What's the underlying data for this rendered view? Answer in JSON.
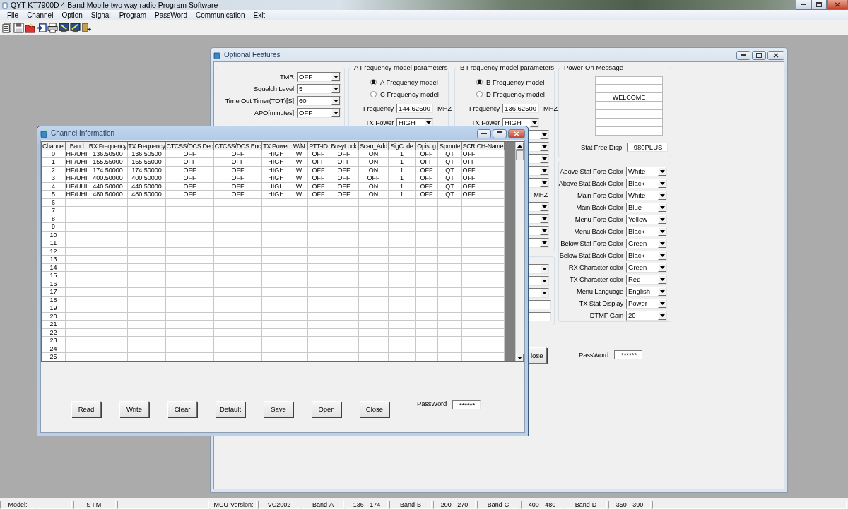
{
  "app": {
    "title": "QYT KT7900D 4 Band Mobile two way radio Program Software",
    "menu": [
      "File",
      "Channel",
      "Option",
      "Signal",
      "Program",
      "PassWord",
      "Communication",
      "Exit"
    ]
  },
  "optional_features": {
    "title": "Optional Features",
    "general": [
      {
        "label": "TMR",
        "value": "OFF"
      },
      {
        "label": "Squelch Level",
        "value": "5"
      },
      {
        "label": "Time Out Timer(TOT)[S]",
        "value": "60"
      },
      {
        "label": "APO[minutes]",
        "value": "OFF"
      }
    ],
    "a_params": {
      "legend": "A Frequency model parameters",
      "models": [
        {
          "label": "A Frequency model",
          "selected": true
        },
        {
          "label": "C Frequency model",
          "selected": false
        }
      ],
      "frequency_label": "Frequency",
      "frequency": "144.62500",
      "unit": "MHZ",
      "tx_power_label": "TX Power",
      "tx_power": "HIGH"
    },
    "b_params": {
      "legend": "B Frequency model parameters",
      "models": [
        {
          "label": "B Frequency model",
          "selected": true
        },
        {
          "label": "D Frequency model",
          "selected": false
        }
      ],
      "frequency_label": "Frequency",
      "frequency": "136.62500",
      "unit": "MHZ",
      "tx_power_label": "TX Power",
      "tx_power": "HIGH",
      "second_unit": "MHZ"
    },
    "close_button": "lose",
    "password_label": "PassWord",
    "password": "******",
    "power_on": {
      "legend": "Power-On Message",
      "lines": [
        {
          "kind": "blank"
        },
        {
          "kind": "blank"
        },
        {
          "kind": "text",
          "text": "WELCOME"
        },
        {
          "kind": "blank"
        },
        {
          "kind": "blank"
        },
        {
          "kind": "blank"
        },
        {
          "kind": "blank"
        }
      ],
      "stat_free_label": "Stat Free Disp",
      "stat_free": "980PLUS"
    },
    "colors": [
      {
        "label": "Above Stat Fore Color",
        "value": "White"
      },
      {
        "label": "Above Stat Back Color",
        "value": "Black"
      },
      {
        "label": "Main Fore Color",
        "value": "White"
      },
      {
        "label": "Main Back Color",
        "value": "Blue"
      },
      {
        "label": "Menu Fore Color",
        "value": "Yellow"
      },
      {
        "label": "Menu Back Color",
        "value": "Black"
      },
      {
        "label": "Below Stat Fore Color",
        "value": "Green"
      },
      {
        "label": "Below Stat Back Color",
        "value": "Black"
      },
      {
        "label": "RX Character color",
        "value": "Green"
      },
      {
        "label": "TX Character color",
        "value": "Red"
      },
      {
        "label": "Menu Language",
        "value": "English"
      },
      {
        "label": "TX Stat Display",
        "value": "Power"
      },
      {
        "label": "DTMF Gain",
        "value": "20"
      }
    ]
  },
  "channel_info": {
    "title": "Channel Information",
    "columns": [
      "Channel",
      "Band",
      "RX Frequency",
      "TX Frequency",
      "CTCSS/DCS Dec",
      "CTCSS/DCS Enc",
      "TX Power",
      "W/N",
      "PTT-ID",
      "BusyLock",
      "Scan_Add",
      "SigCode",
      "Opisug",
      "Spmute",
      "SCR",
      "CH-Name"
    ],
    "rows": [
      [
        "0",
        "HF/UHI",
        "136.50500",
        "136.50500",
        "OFF",
        "OFF",
        "HIGH",
        "W",
        "OFF",
        "OFF",
        "ON",
        "1",
        "OFF",
        "QT",
        "OFF"
      ],
      [
        "1",
        "HF/UHI",
        "155.55000",
        "155.55000",
        "OFF",
        "OFF",
        "HIGH",
        "W",
        "OFF",
        "OFF",
        "ON",
        "1",
        "OFF",
        "QT",
        "OFF"
      ],
      [
        "2",
        "HF/UHI",
        "174.50000",
        "174.50000",
        "OFF",
        "OFF",
        "HIGH",
        "W",
        "OFF",
        "OFF",
        "ON",
        "1",
        "OFF",
        "QT",
        "OFF"
      ],
      [
        "3",
        "HF/UHI",
        "400.50000",
        "400.50000",
        "OFF",
        "OFF",
        "HIGH",
        "W",
        "OFF",
        "OFF",
        "OFF",
        "1",
        "OFF",
        "QT",
        "OFF"
      ],
      [
        "4",
        "HF/UHI",
        "440.50000",
        "440.50000",
        "OFF",
        "OFF",
        "HIGH",
        "W",
        "OFF",
        "OFF",
        "ON",
        "1",
        "OFF",
        "QT",
        "OFF"
      ],
      [
        "5",
        "HF/UHI",
        "480.50000",
        "480.50000",
        "OFF",
        "OFF",
        "HIGH",
        "W",
        "OFF",
        "OFF",
        "ON",
        "1",
        "OFF",
        "QT",
        "OFF"
      ],
      [
        "6"
      ],
      [
        "7"
      ],
      [
        "8"
      ],
      [
        "9"
      ],
      [
        "10"
      ],
      [
        "11"
      ],
      [
        "12"
      ],
      [
        "13"
      ],
      [
        "14"
      ],
      [
        "15"
      ],
      [
        "16"
      ],
      [
        "17"
      ],
      [
        "18"
      ],
      [
        "19"
      ],
      [
        "20"
      ],
      [
        "21"
      ],
      [
        "22"
      ],
      [
        "23"
      ],
      [
        "24"
      ],
      [
        "25"
      ]
    ],
    "buttons": [
      "Read",
      "Write",
      "Clear",
      "Default",
      "Save",
      "Open",
      "Close"
    ],
    "password_label": "PassWord",
    "password": "******"
  },
  "status_bar": [
    {
      "kind": "text",
      "text": "Model:"
    },
    {
      "kind": "blank"
    },
    {
      "kind": "text",
      "text": "S I M:"
    },
    {
      "kind": "blank"
    },
    {
      "text": "MCU-Version:"
    },
    {
      "text": "VC2002"
    },
    {
      "text": "Band-A"
    },
    {
      "text": "136-- 174"
    },
    {
      "text": "Band-B"
    },
    {
      "text": "200-- 270"
    },
    {
      "text": "Band-C"
    },
    {
      "text": "400-- 480"
    },
    {
      "text": "Band-D"
    },
    {
      "text": "350-- 390"
    },
    {
      "kind": "blank"
    }
  ]
}
